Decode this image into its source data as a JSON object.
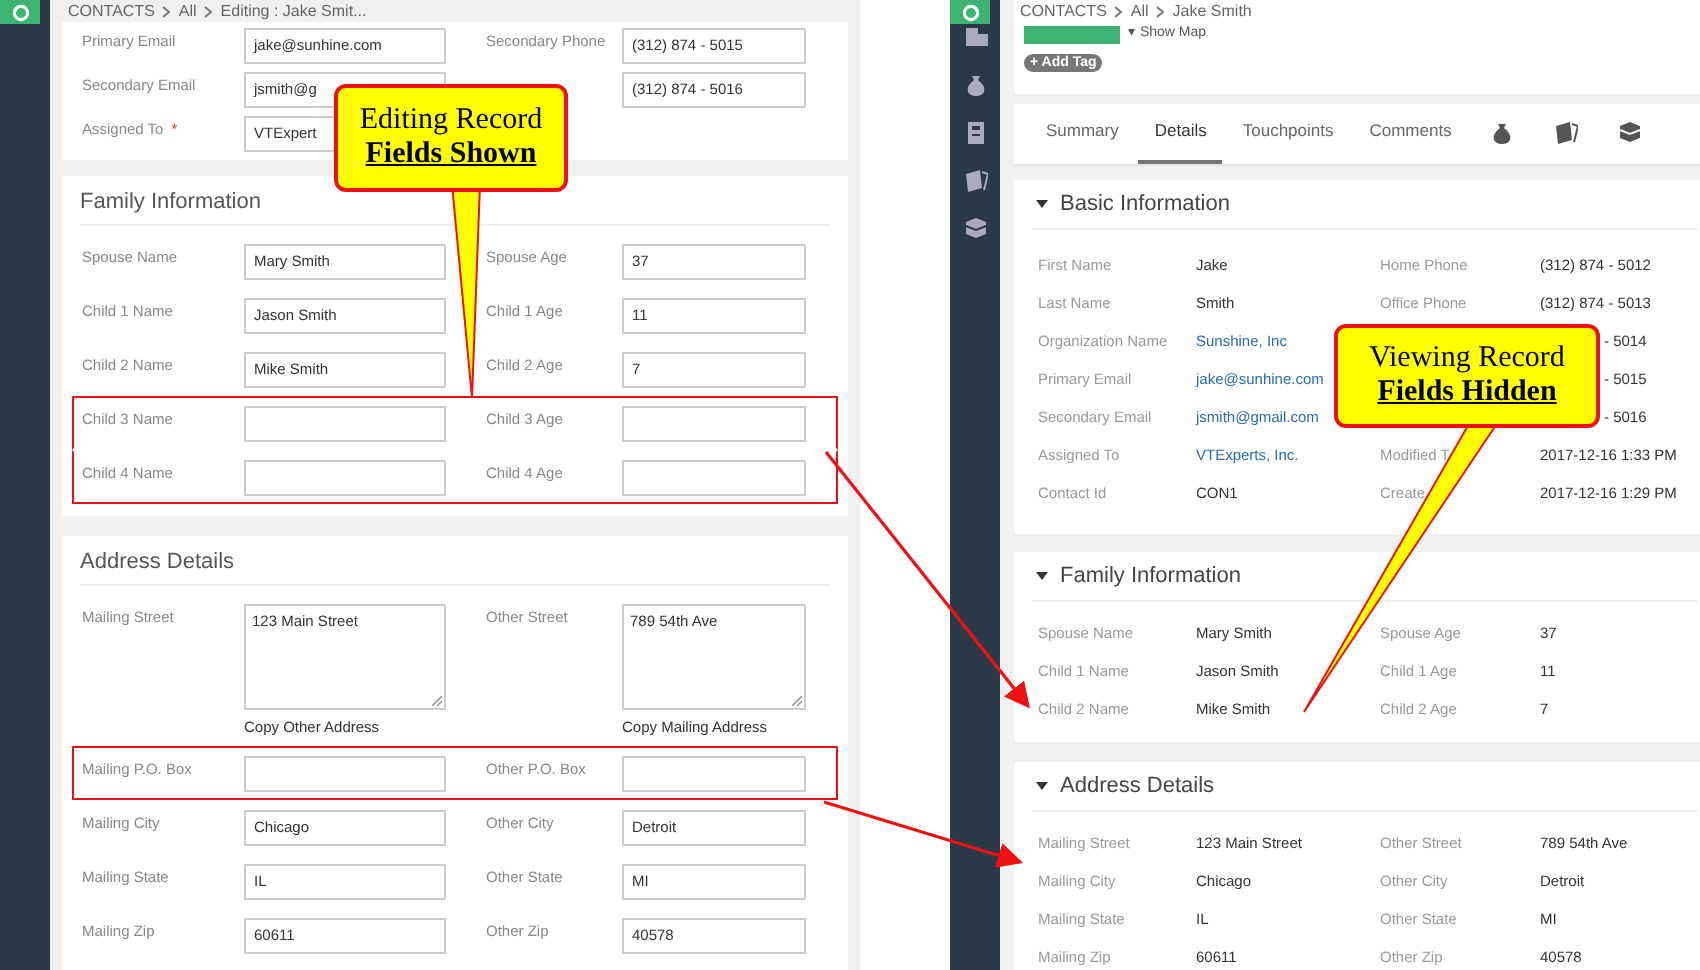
{
  "edit_view": {
    "breadcrumb": {
      "module": "CONTACTS",
      "path": [
        "All",
        "Editing : Jake Smit..."
      ]
    },
    "sections": [
      {
        "rows": [
          {
            "kind": "input",
            "highlighted": false,
            "fields": [
              {
                "label": "Primary Email",
                "value": "jake@sunhine.com"
              },
              {
                "label": "Secondary Phone",
                "value": "(312) 874 - 5015"
              }
            ]
          },
          {
            "kind": "input",
            "highlighted": false,
            "fields": [
              {
                "label": "Secondary Email",
                "value": "jsmith@g"
              },
              {
                "value": "(312) 874 - 5016"
              }
            ]
          },
          {
            "kind": "input",
            "highlighted": false,
            "fields": [
              {
                "label": "Assigned To",
                "marker": "*",
                "value": "VTExpert"
              }
            ]
          }
        ]
      },
      {
        "title": "Family Information",
        "rows": [
          {
            "kind": "input",
            "highlighted": false,
            "fields": [
              {
                "label": "Spouse Name",
                "value": "Mary Smith"
              },
              {
                "label": "Spouse Age",
                "value": "37"
              }
            ]
          },
          {
            "kind": "input",
            "highlighted": false,
            "fields": [
              {
                "label": "Child 1 Name",
                "value": "Jason Smith"
              },
              {
                "label": "Child 1 Age",
                "value": "11"
              }
            ]
          },
          {
            "kind": "input",
            "highlighted": false,
            "fields": [
              {
                "label": "Child 2 Name",
                "value": "Mike Smith"
              },
              {
                "label": "Child 2 Age",
                "value": "7"
              }
            ]
          },
          {
            "kind": "input",
            "highlighted": true,
            "fields": [
              {
                "label": "Child 3 Name"
              },
              {
                "label": "Child 3 Age"
              }
            ]
          },
          {
            "kind": "input",
            "highlighted": true,
            "fields": [
              {
                "label": "Child 4 Name"
              },
              {
                "label": "Child 4 Age"
              }
            ]
          }
        ]
      },
      {
        "title": "Address Details",
        "rows": [
          {
            "kind": "textarea",
            "highlighted": false,
            "fields": [
              {
                "label": "Mailing Street",
                "value": "123 Main Street",
                "link": "Copy Other Address"
              },
              {
                "label": "Other Street",
                "value": "789 54th Ave",
                "link": "Copy Mailing Address"
              }
            ]
          },
          {
            "kind": "input",
            "highlighted": true,
            "fields": [
              {
                "label": "Mailing P.O. Box"
              },
              {
                "label": "Other P.O. Box"
              }
            ]
          },
          {
            "kind": "input",
            "highlighted": false,
            "fields": [
              {
                "label": "Mailing City",
                "value": "Chicago"
              },
              {
                "label": "Other City",
                "value": "Detroit"
              }
            ]
          },
          {
            "kind": "input",
            "highlighted": false,
            "fields": [
              {
                "label": "Mailing State",
                "value": "IL"
              },
              {
                "label": "Other State",
                "value": "MI"
              }
            ]
          },
          {
            "kind": "input",
            "highlighted": false,
            "fields": [
              {
                "label": "Mailing Zip",
                "value": "60611"
              },
              {
                "label": "Other Zip",
                "value": "40578"
              }
            ]
          }
        ]
      }
    ]
  },
  "detail_view": {
    "breadcrumb": {
      "module": "CONTACTS",
      "path": [
        "All",
        "Jake Smith"
      ]
    },
    "show_map": "▾ Show Map",
    "add_tag": "+ Add Tag",
    "tabs": [
      {
        "label": "Summary",
        "selected": false
      },
      {
        "label": "Details",
        "selected": true
      },
      {
        "label": "Touchpoints",
        "selected": false
      },
      {
        "label": "Comments",
        "selected": false
      }
    ],
    "sections": [
      {
        "title": "Basic Information",
        "expanded": true,
        "rows": [
          [
            {
              "label": "First Name",
              "value": "Jake"
            },
            {
              "label": "Home Phone",
              "value": "(312) 874 - 5012"
            }
          ],
          [
            {
              "label": "Last Name",
              "value": "Smith"
            },
            {
              "label": "Office Phone",
              "value": "(312) 874 - 5013"
            }
          ],
          [
            {
              "label": "Organization Name",
              "value": "Sunshine, Inc",
              "link": true
            },
            {
              "value": "- 5014"
            }
          ],
          [
            {
              "label": "Primary Email",
              "value": "jake@sunhine.com",
              "link": true
            },
            {
              "value": "- 5015"
            }
          ],
          [
            {
              "label": "Secondary Email",
              "value": "jsmith@gmail.com",
              "link": true
            },
            {
              "value": "- 5016"
            }
          ],
          [
            {
              "label": "Assigned To",
              "value": "VTExperts, Inc.",
              "link": true
            },
            {
              "label": "Modified T",
              "value": "2017-12-16 1:33 PM"
            }
          ],
          [
            {
              "label": "Contact Id",
              "value": "CON1"
            },
            {
              "label": "Create",
              "value": "2017-12-16 1:29 PM"
            }
          ]
        ]
      },
      {
        "title": "Family Information",
        "expanded": true,
        "rows": [
          [
            {
              "label": "Spouse Name",
              "value": "Mary Smith"
            },
            {
              "label": "Spouse Age",
              "value": "37"
            }
          ],
          [
            {
              "label": "Child 1 Name",
              "value": "Jason Smith"
            },
            {
              "label": "Child 1 Age",
              "value": "11"
            }
          ],
          [
            {
              "label": "Child 2 Name",
              "value": "Mike Smith"
            },
            {
              "label": "Child 2 Age",
              "value": "7"
            }
          ]
        ]
      },
      {
        "title": "Address Details",
        "expanded": true,
        "rows": [
          [
            {
              "label": "Mailing Street",
              "value": "123 Main Street"
            },
            {
              "label": "Other Street",
              "value": "789 54th Ave"
            }
          ],
          [
            {
              "label": "Mailing City",
              "value": "Chicago"
            },
            {
              "label": "Other City",
              "value": "Detroit"
            }
          ],
          [
            {
              "label": "Mailing State",
              "value": "IL"
            },
            {
              "label": "Other State",
              "value": "MI"
            }
          ],
          [
            {
              "label": "Mailing Zip",
              "value": "60611"
            },
            {
              "label": "Other Zip",
              "value": "40578"
            }
          ]
        ]
      }
    ]
  },
  "callouts": [
    {
      "line_1": "Editing Record",
      "line_2": "Fields Shown"
    },
    {
      "line_1": "Viewing Record",
      "line_2": "Fields Hidden"
    }
  ]
}
